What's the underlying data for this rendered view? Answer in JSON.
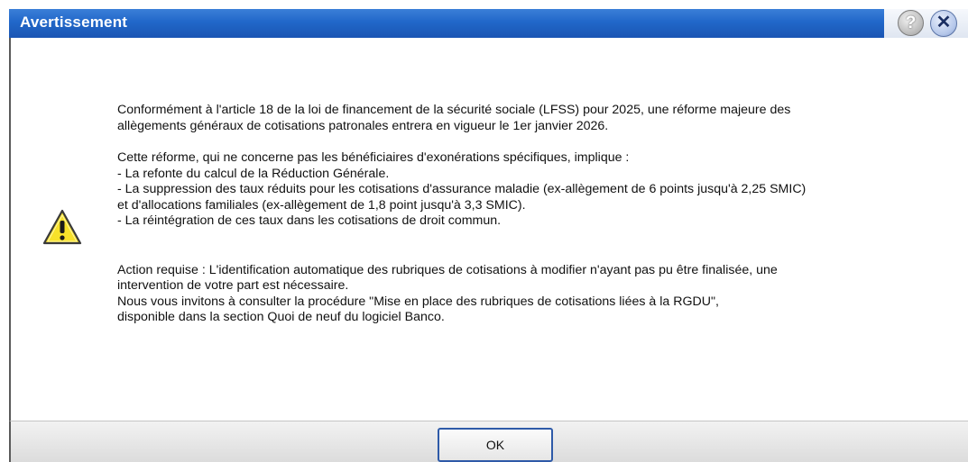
{
  "window": {
    "title": "Avertissement",
    "help_glyph": "?",
    "close_glyph": "✕"
  },
  "icon": {
    "name": "warning-icon",
    "color": "#f7e12a"
  },
  "message": {
    "para1_line1": "Conformément à l'article 18 de la loi de financement de la sécurité sociale (LFSS) pour 2025, une réforme majeure des",
    "para1_line2": "allègements généraux de cotisations patronales entrera en vigueur le 1er janvier 2026.",
    "para2_line1": "Cette réforme, qui ne concerne pas les bénéficiaires d'exonérations spécifiques, implique :",
    "para2_line2": "- La refonte du calcul de la Réduction Générale.",
    "para2_line3": "- La suppression des taux réduits pour les cotisations d'assurance maladie (ex-allègement de 6 points jusqu'à 2,25 SMIC)",
    "para2_line4": "et d'allocations familiales (ex-allègement de 1,8 point jusqu'à 3,3 SMIC).",
    "para2_line5": "- La réintégration de ces taux dans les cotisations de droit commun.",
    "para3_line1": "Action requise : L'identification automatique des rubriques de cotisations à modifier n'ayant pas pu être finalisée, une",
    "para3_line2": "intervention de votre part est nécessaire.",
    "para3_line3": "Nous vous invitons à consulter la procédure \"Mise en place des rubriques de cotisations liées à la RGDU\",",
    "para3_line4": "disponible dans la section Quoi de neuf du logiciel Banco."
  },
  "footer": {
    "ok_label": "OK"
  }
}
